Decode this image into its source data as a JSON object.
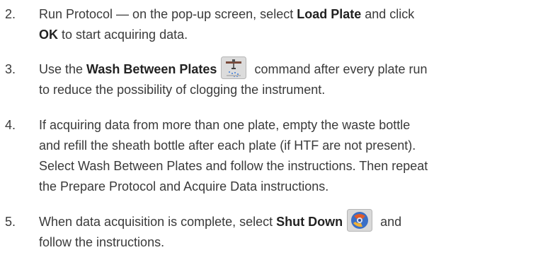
{
  "steps": [
    {
      "number": "2.",
      "l1_a": "Run Protocol — on the pop-up screen, select ",
      "l1_b": "Load Plate",
      "l1_c": " and click",
      "l2_a": "OK",
      "l2_b": " to start acquiring data."
    },
    {
      "number": "3.",
      "l1_a": "Use the ",
      "l1_b": "Wash Between Plates",
      "l1_c": " command after every plate run",
      "l2": "to reduce the possibility of clogging the instrument.",
      "icon": "wash-between-plates-icon"
    },
    {
      "number": "4.",
      "lines": [
        "If acquiring data from more than one plate, empty the waste bottle",
        "and refill the sheath bottle after each plate (if HTF are not present).",
        "Select Wash Between Plates and follow the instructions. Then repeat",
        "the Prepare Protocol and Acquire Data instructions."
      ]
    },
    {
      "number": "5.",
      "l1_a": "When data acquisition is complete, select ",
      "l1_b": "Shut Down",
      "l1_c": " and",
      "l2": "follow the instructions.",
      "icon": "shut-down-icon"
    }
  ]
}
